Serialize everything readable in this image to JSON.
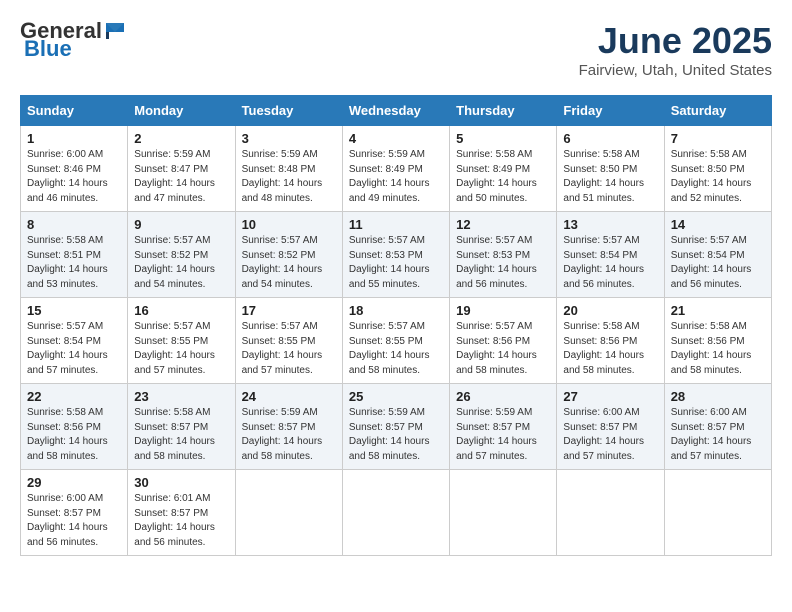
{
  "logo": {
    "general": "General",
    "blue": "Blue"
  },
  "title": "June 2025",
  "location": "Fairview, Utah, United States",
  "days_of_week": [
    "Sunday",
    "Monday",
    "Tuesday",
    "Wednesday",
    "Thursday",
    "Friday",
    "Saturday"
  ],
  "weeks": [
    [
      {
        "day": 1,
        "sunrise": "6:00 AM",
        "sunset": "8:46 PM",
        "daylight": "14 hours and 46 minutes."
      },
      {
        "day": 2,
        "sunrise": "5:59 AM",
        "sunset": "8:47 PM",
        "daylight": "14 hours and 47 minutes."
      },
      {
        "day": 3,
        "sunrise": "5:59 AM",
        "sunset": "8:48 PM",
        "daylight": "14 hours and 48 minutes."
      },
      {
        "day": 4,
        "sunrise": "5:59 AM",
        "sunset": "8:49 PM",
        "daylight": "14 hours and 49 minutes."
      },
      {
        "day": 5,
        "sunrise": "5:58 AM",
        "sunset": "8:49 PM",
        "daylight": "14 hours and 50 minutes."
      },
      {
        "day": 6,
        "sunrise": "5:58 AM",
        "sunset": "8:50 PM",
        "daylight": "14 hours and 51 minutes."
      },
      {
        "day": 7,
        "sunrise": "5:58 AM",
        "sunset": "8:50 PM",
        "daylight": "14 hours and 52 minutes."
      }
    ],
    [
      {
        "day": 8,
        "sunrise": "5:58 AM",
        "sunset": "8:51 PM",
        "daylight": "14 hours and 53 minutes."
      },
      {
        "day": 9,
        "sunrise": "5:57 AM",
        "sunset": "8:52 PM",
        "daylight": "14 hours and 54 minutes."
      },
      {
        "day": 10,
        "sunrise": "5:57 AM",
        "sunset": "8:52 PM",
        "daylight": "14 hours and 54 minutes."
      },
      {
        "day": 11,
        "sunrise": "5:57 AM",
        "sunset": "8:53 PM",
        "daylight": "14 hours and 55 minutes."
      },
      {
        "day": 12,
        "sunrise": "5:57 AM",
        "sunset": "8:53 PM",
        "daylight": "14 hours and 56 minutes."
      },
      {
        "day": 13,
        "sunrise": "5:57 AM",
        "sunset": "8:54 PM",
        "daylight": "14 hours and 56 minutes."
      },
      {
        "day": 14,
        "sunrise": "5:57 AM",
        "sunset": "8:54 PM",
        "daylight": "14 hours and 56 minutes."
      }
    ],
    [
      {
        "day": 15,
        "sunrise": "5:57 AM",
        "sunset": "8:54 PM",
        "daylight": "14 hours and 57 minutes."
      },
      {
        "day": 16,
        "sunrise": "5:57 AM",
        "sunset": "8:55 PM",
        "daylight": "14 hours and 57 minutes."
      },
      {
        "day": 17,
        "sunrise": "5:57 AM",
        "sunset": "8:55 PM",
        "daylight": "14 hours and 57 minutes."
      },
      {
        "day": 18,
        "sunrise": "5:57 AM",
        "sunset": "8:55 PM",
        "daylight": "14 hours and 58 minutes."
      },
      {
        "day": 19,
        "sunrise": "5:57 AM",
        "sunset": "8:56 PM",
        "daylight": "14 hours and 58 minutes."
      },
      {
        "day": 20,
        "sunrise": "5:58 AM",
        "sunset": "8:56 PM",
        "daylight": "14 hours and 58 minutes."
      },
      {
        "day": 21,
        "sunrise": "5:58 AM",
        "sunset": "8:56 PM",
        "daylight": "14 hours and 58 minutes."
      }
    ],
    [
      {
        "day": 22,
        "sunrise": "5:58 AM",
        "sunset": "8:56 PM",
        "daylight": "14 hours and 58 minutes."
      },
      {
        "day": 23,
        "sunrise": "5:58 AM",
        "sunset": "8:57 PM",
        "daylight": "14 hours and 58 minutes."
      },
      {
        "day": 24,
        "sunrise": "5:59 AM",
        "sunset": "8:57 PM",
        "daylight": "14 hours and 58 minutes."
      },
      {
        "day": 25,
        "sunrise": "5:59 AM",
        "sunset": "8:57 PM",
        "daylight": "14 hours and 58 minutes."
      },
      {
        "day": 26,
        "sunrise": "5:59 AM",
        "sunset": "8:57 PM",
        "daylight": "14 hours and 57 minutes."
      },
      {
        "day": 27,
        "sunrise": "6:00 AM",
        "sunset": "8:57 PM",
        "daylight": "14 hours and 57 minutes."
      },
      {
        "day": 28,
        "sunrise": "6:00 AM",
        "sunset": "8:57 PM",
        "daylight": "14 hours and 57 minutes."
      }
    ],
    [
      {
        "day": 29,
        "sunrise": "6:00 AM",
        "sunset": "8:57 PM",
        "daylight": "14 hours and 56 minutes."
      },
      {
        "day": 30,
        "sunrise": "6:01 AM",
        "sunset": "8:57 PM",
        "daylight": "14 hours and 56 minutes."
      },
      null,
      null,
      null,
      null,
      null
    ]
  ],
  "labels": {
    "sunrise": "Sunrise:",
    "sunset": "Sunset:",
    "daylight": "Daylight:"
  }
}
